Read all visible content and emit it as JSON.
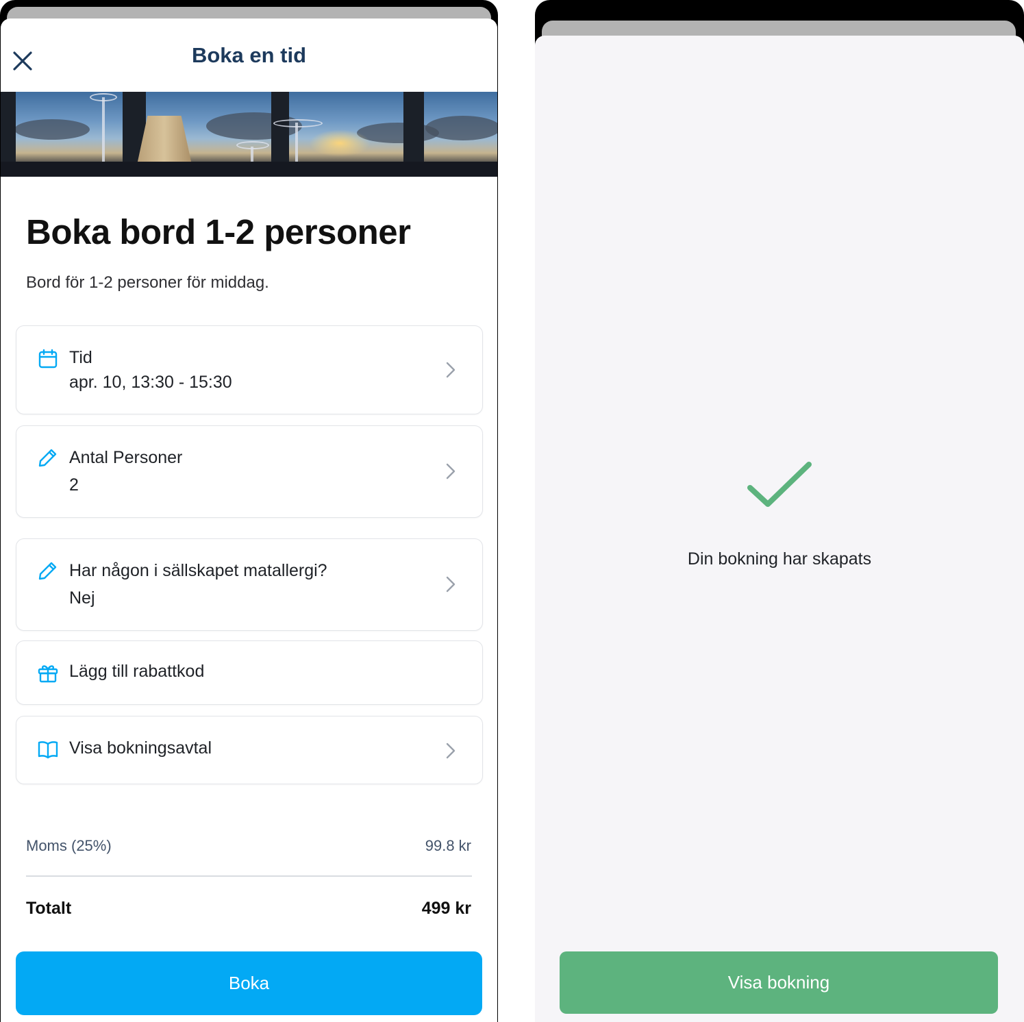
{
  "left_screen": {
    "nav_title": "Boka en tid",
    "title": "Boka bord 1-2 personer",
    "description": "Bord för 1-2 personer för middag.",
    "cards": {
      "time": {
        "icon": "calendar-icon",
        "label": "Tid",
        "value": "apr. 10, 13:30 - 15:30"
      },
      "persons": {
        "icon": "pencil-icon",
        "label": "Antal Personer",
        "value": "2"
      },
      "allergy": {
        "icon": "pencil-icon",
        "label": "Har någon i sällskapet matallergi?",
        "value": "Nej"
      },
      "discount": {
        "icon": "gift-icon",
        "label": "Lägg till rabattkod"
      },
      "agreement": {
        "icon": "book-icon",
        "label": "Visa bokningsavtal"
      }
    },
    "summary": {
      "vat_label": "Moms (25%)",
      "vat_value": "99.8 kr",
      "total_label": "Totalt",
      "total_value": "499 kr"
    },
    "button_label": "Boka"
  },
  "right_screen": {
    "success_message": "Din bokning har skapats",
    "button_label": "Visa bokning"
  },
  "colors": {
    "accent_blue": "#03a9f4",
    "success_green": "#5db37e",
    "nav_title": "#1d3a5c"
  }
}
